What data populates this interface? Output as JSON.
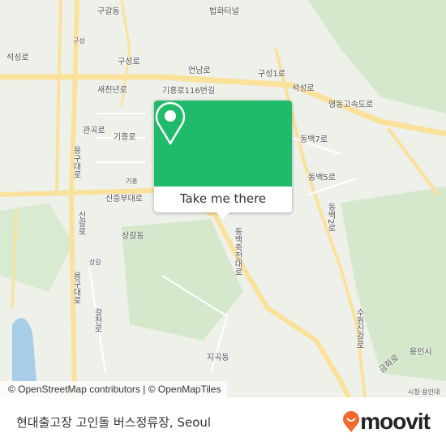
{
  "map": {
    "labels": [
      "석성로",
      "구성",
      "구성로",
      "언남로",
      "새천년로",
      "기흥로116번길",
      "구성1로",
      "석성로",
      "영동고속도로",
      "관곡로",
      "기흥로",
      "동백7로",
      "용구대로",
      "동백5로",
      "신중부대로",
      "기흥",
      "상갈동",
      "신갈로",
      "동백2로",
      "상갈",
      "용구대로",
      "지곡동",
      "금화로",
      "용인시",
      "수원신갈로",
      "시청·용인대",
      "동백죽전대로",
      "갈천로",
      "법화터널",
      "구갈동"
    ],
    "colors": {
      "background": "#eef0ea",
      "park": "#cfe6c4",
      "road": "#fbe29a",
      "water": "#a8cde8"
    }
  },
  "attribution": "© OpenStreetMap contributors | © OpenMapTiles",
  "popup": {
    "icon": "map-pin-icon",
    "button_label": "Take me there",
    "color": "#1fba6a"
  },
  "footer": {
    "title": "현대출고장 고인돌 버스정류장, Seoul",
    "logo_text": "moovit",
    "logo_color": "#f26b2a"
  }
}
